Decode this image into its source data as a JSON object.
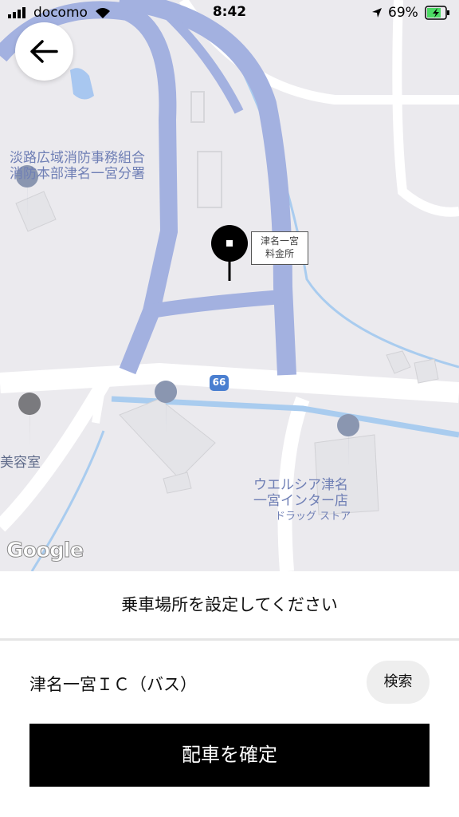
{
  "status_bar": {
    "carrier": "docomo",
    "time": "8:42",
    "battery": "69%"
  },
  "map": {
    "labels": {
      "fire_dept": "淡路広域消防事務組合\n消防本部津名一宮分署",
      "toll_booth": "津名一宮\n料金所",
      "beauty_salon": "美容室",
      "store_name": "ウエルシア津名\n一宮インター店",
      "store_type": "ドラッグ ストア",
      "route": "66"
    },
    "attribution": "Google"
  },
  "panel": {
    "prompt": "乗車場所を設定してください",
    "location": "津名一宮ＩＣ（バス）",
    "search_label": "検索",
    "confirm_label": "配車を確定"
  }
}
